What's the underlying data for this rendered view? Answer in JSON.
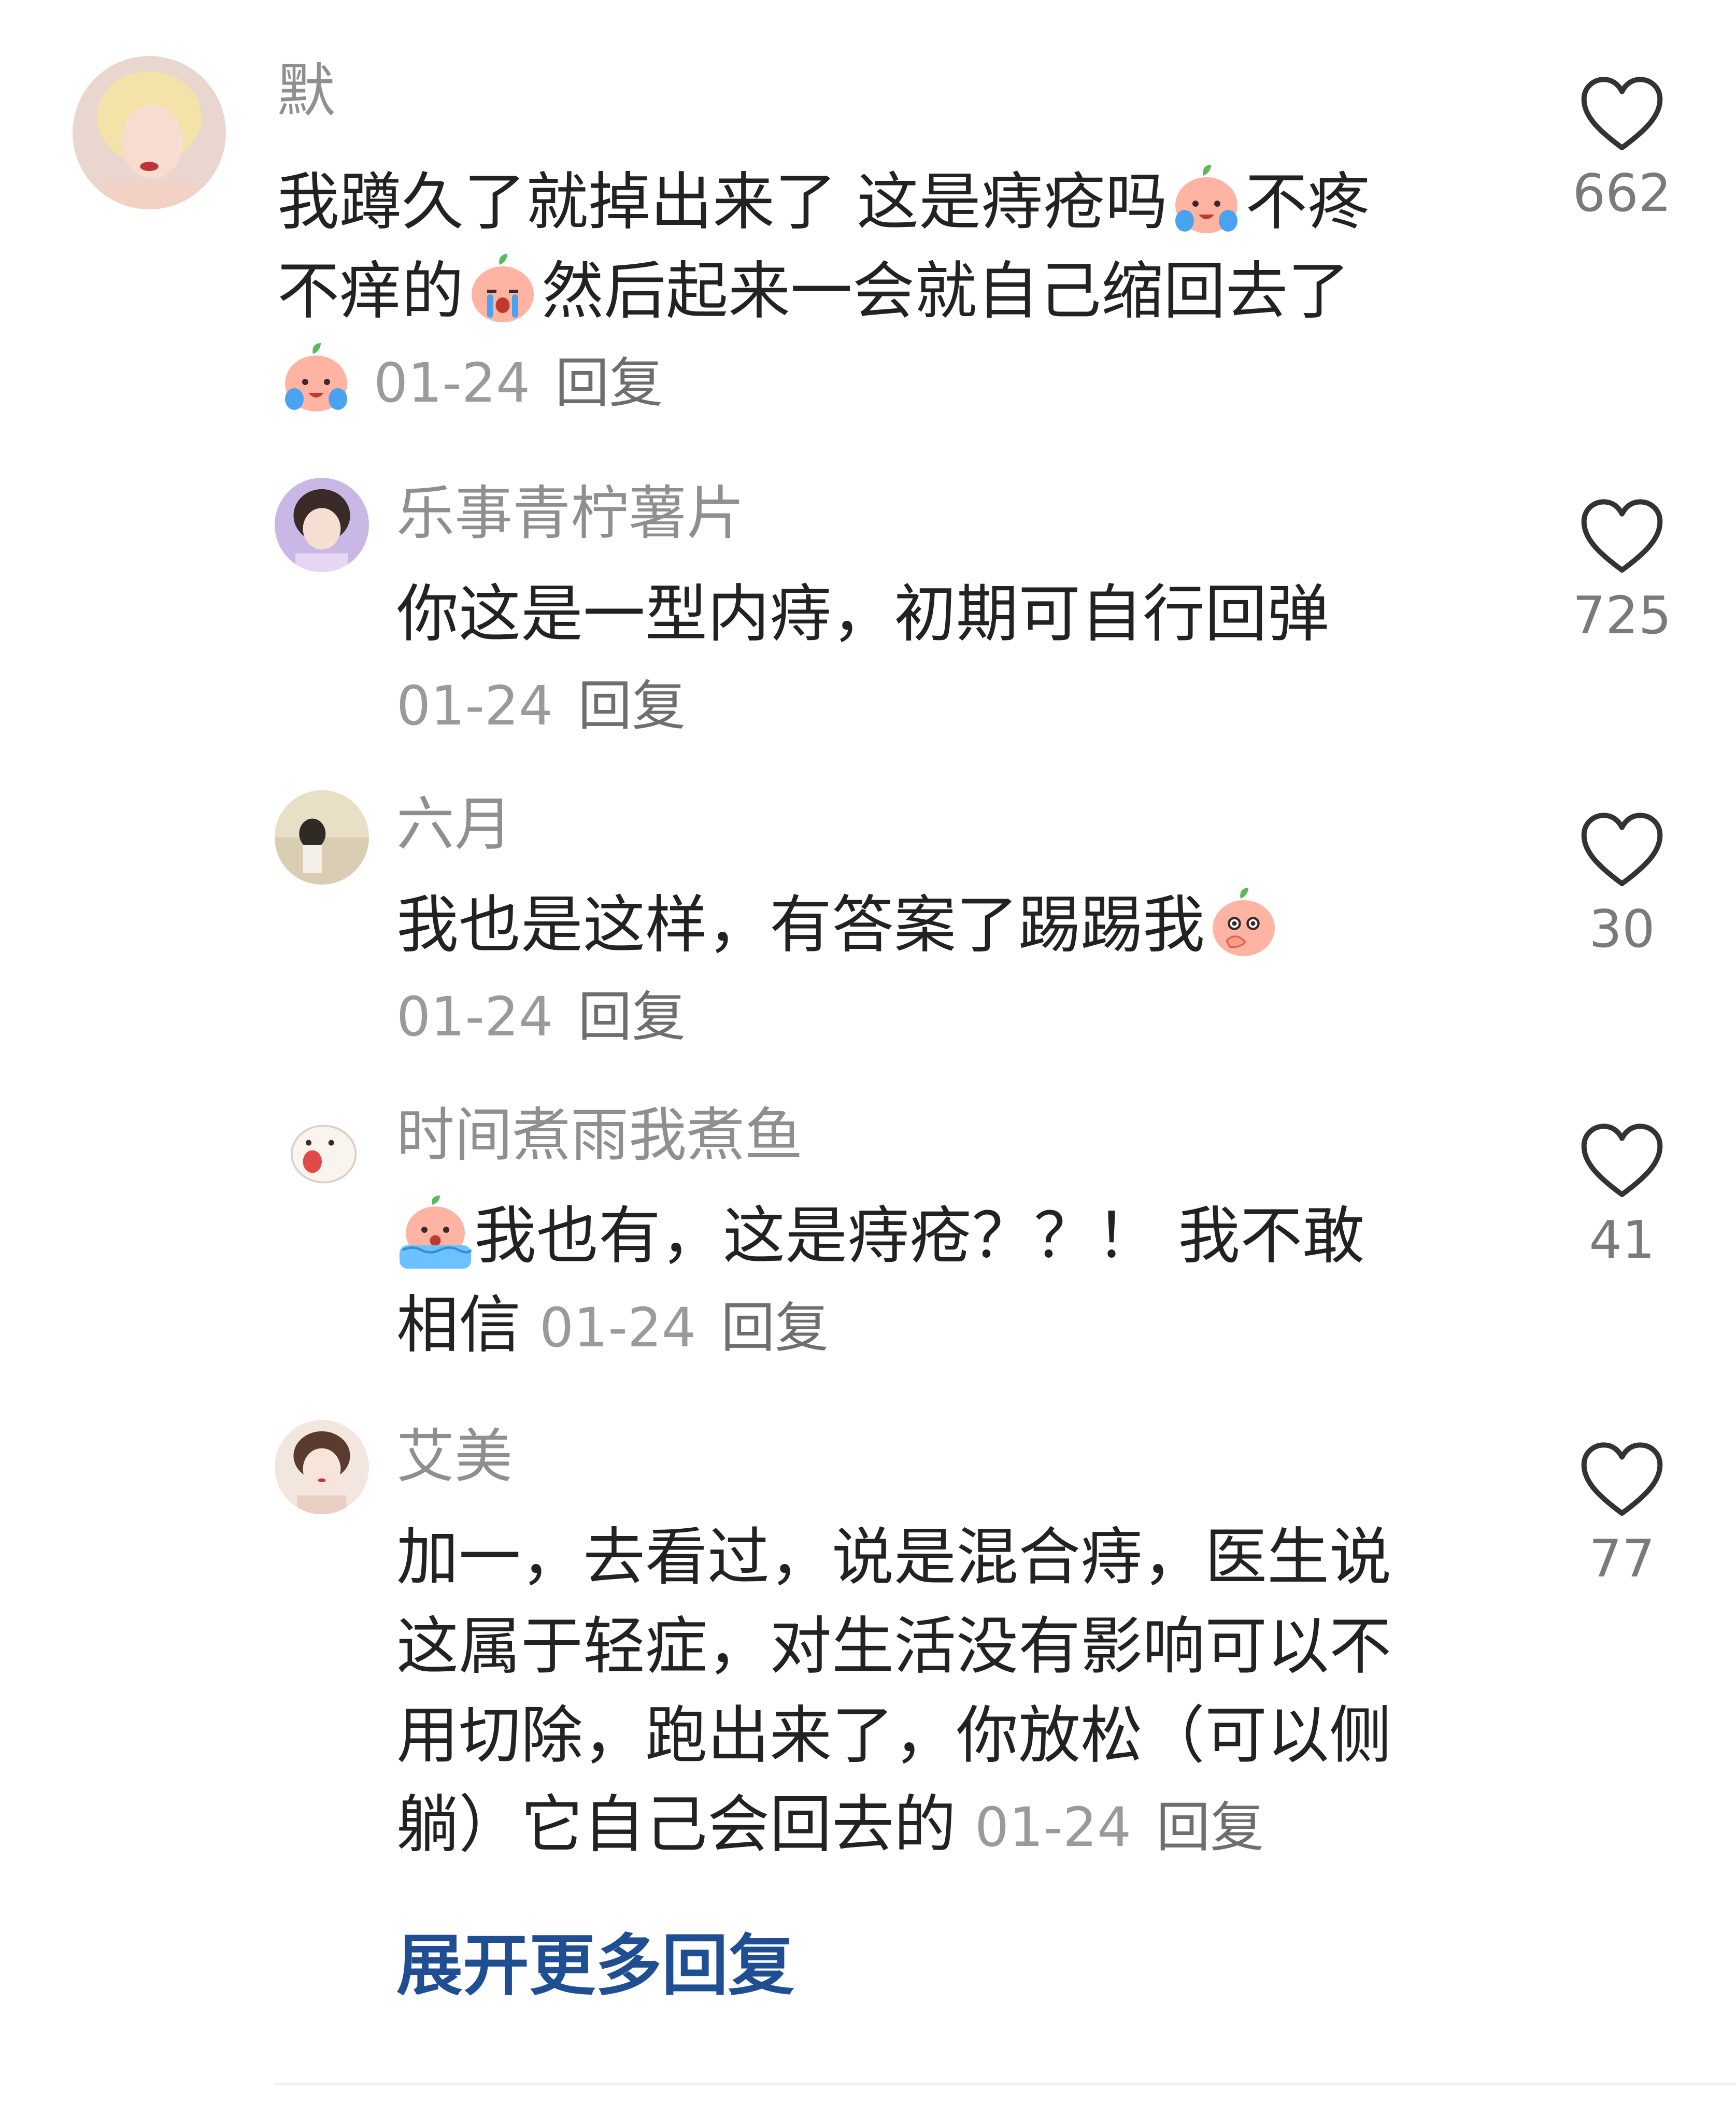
{
  "comments": [
    {
      "user": "默",
      "line1_a": "我蹲久了就掉出来了  这是痔疮吗",
      "line1_b": "不疼",
      "line2_a": "不痒的",
      "line2_b": "然后起来一会就自己缩回去了",
      "emoji1": "crying-face-emoji",
      "emoji2": "sobbing-face-emoji",
      "emoji3": "crying-face-emoji",
      "date": "01-24",
      "reply": "回复",
      "likes": "662"
    },
    {
      "user": "乐事青柠薯片",
      "text": "你这是一型内痔，初期可自行回弹",
      "date": "01-24",
      "reply": "回复",
      "likes": "725"
    },
    {
      "user": "六月",
      "text": "我也是这样，有答案了踢踢我",
      "emoji": "peeking-face-emoji",
      "date": "01-24",
      "reply": "回复",
      "likes": "30"
    },
    {
      "user": "时间煮雨我煮鱼",
      "line1": "我也有，这是痔疮？？！ 我不敢",
      "line2": "相信",
      "emoji": "flooding-tears-emoji",
      "date": "01-24",
      "reply": "回复",
      "likes": "41"
    },
    {
      "user": "艾美",
      "line1": "加一，去看过，说是混合痔，医生说",
      "line2": "这属于轻症，对生活没有影响可以不",
      "line3": "用切除，跑出来了，你放松（可以侧",
      "line4": "躺）它自己会回去的",
      "date": "01-24",
      "reply": "回复",
      "likes": "77"
    }
  ],
  "expand_more": "展开更多回复",
  "colors": {
    "text": "#222222",
    "username": "#8f8f8f",
    "meta": "#9a9a9a",
    "link": "#1f4e93",
    "heart_outline": "#333333"
  }
}
